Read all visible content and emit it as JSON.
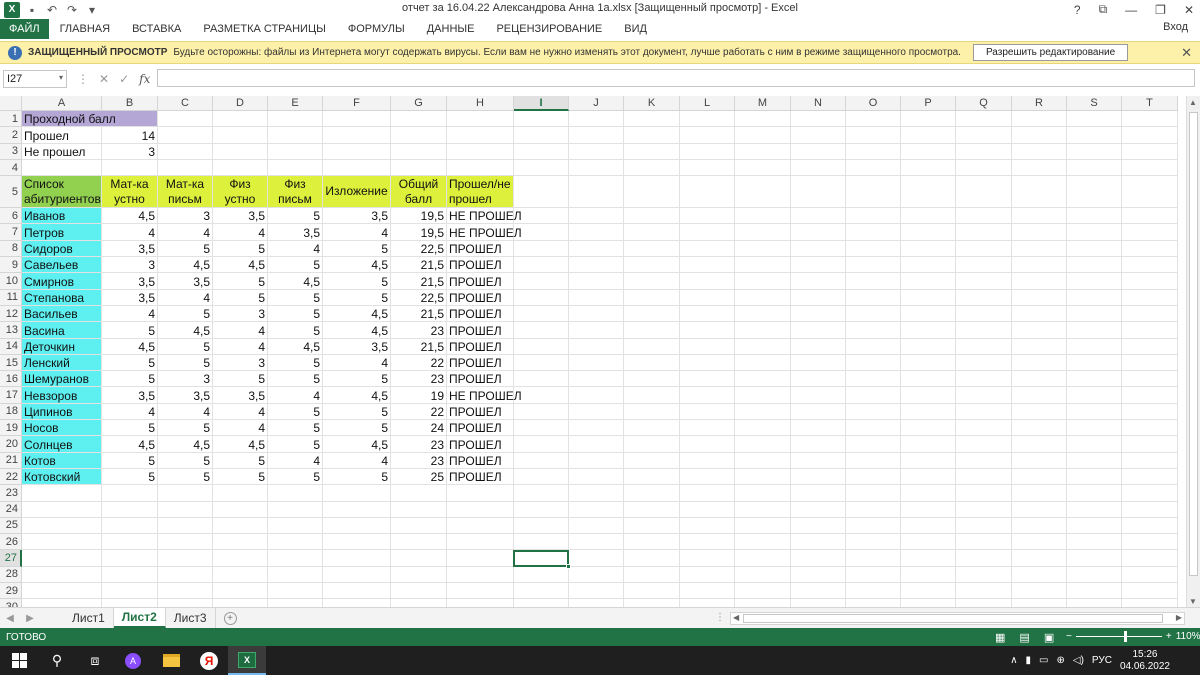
{
  "window": {
    "title": "отчет за 16.04.22 Александрова Анна 1a.xlsx  [Защищенный просмотр] - Excel",
    "signin": "Вход",
    "help": "?",
    "app_badge": "X",
    "qat_save": "▪",
    "qat_undo": "↶",
    "qat_redo": "↷",
    "qat_more": "▾",
    "ribbon_display": "⧉",
    "minimize": "—",
    "restore": "❐",
    "close": "✕"
  },
  "ribbon_tabs": [
    "ФАЙЛ",
    "ГЛАВНАЯ",
    "ВСТАВКА",
    "РАЗМЕТКА СТРАНИЦЫ",
    "ФОРМУЛЫ",
    "ДАННЫЕ",
    "РЕЦЕНЗИРОВАНИЕ",
    "ВИД"
  ],
  "protected_view": {
    "icon": "!",
    "title": "ЗАЩИЩЕННЫЙ ПРОСМОТР",
    "message": "Будьте осторожны: файлы из Интернета могут содержать вирусы. Если вам не нужно изменять этот документ, лучше работать с ним в режиме защищенного просмотра.",
    "button": "Разрешить редактирование",
    "close": "✕"
  },
  "formula_bar": {
    "name_box": "I27",
    "dropdown": "▾",
    "separator": "⋮",
    "cancel": "✕",
    "enter": "✓",
    "fx": "fx",
    "formula": ""
  },
  "columns": [
    "A",
    "B",
    "C",
    "D",
    "E",
    "F",
    "G",
    "H",
    "I",
    "J",
    "K",
    "L",
    "M",
    "N",
    "O",
    "P",
    "Q",
    "R",
    "S",
    "T"
  ],
  "selected_column": "I",
  "selected_row": 27,
  "summary": {
    "title": "Проходной балл",
    "passed_label": "Прошел",
    "passed_value": "14",
    "failed_label": "Не прошел",
    "failed_value": "3"
  },
  "table_headers": [
    "Список абитуриентов",
    "Мат-ка устно",
    "Мат-ка письм",
    "Физ устно",
    "Физ письм",
    "Изложение",
    "Общий балл",
    "Прошел/не прошел"
  ],
  "students": [
    [
      "Иванов",
      "4,5",
      "3",
      "3,5",
      "5",
      "3,5",
      "19,5",
      "НЕ ПРОШЕЛ"
    ],
    [
      "Петров",
      "4",
      "4",
      "4",
      "3,5",
      "4",
      "19,5",
      "НЕ ПРОШЕЛ"
    ],
    [
      "Сидоров",
      "3,5",
      "5",
      "5",
      "4",
      "5",
      "22,5",
      "ПРОШЕЛ"
    ],
    [
      "Савельев",
      "3",
      "4,5",
      "4,5",
      "5",
      "4,5",
      "21,5",
      "ПРОШЕЛ"
    ],
    [
      "Смирнов",
      "3,5",
      "3,5",
      "5",
      "4,5",
      "5",
      "21,5",
      "ПРОШЕЛ"
    ],
    [
      "Степанова",
      "3,5",
      "4",
      "5",
      "5",
      "5",
      "22,5",
      "ПРОШЕЛ"
    ],
    [
      "Васильев",
      "4",
      "5",
      "3",
      "5",
      "4,5",
      "21,5",
      "ПРОШЕЛ"
    ],
    [
      "Васина",
      "5",
      "4,5",
      "4",
      "5",
      "4,5",
      "23",
      "ПРОШЕЛ"
    ],
    [
      "Деточкин",
      "4,5",
      "5",
      "4",
      "4,5",
      "3,5",
      "21,5",
      "ПРОШЕЛ"
    ],
    [
      "Ленский",
      "5",
      "5",
      "3",
      "5",
      "4",
      "22",
      "ПРОШЕЛ"
    ],
    [
      "Шемуранов",
      "5",
      "3",
      "5",
      "5",
      "5",
      "23",
      "ПРОШЕЛ"
    ],
    [
      "Невзоров",
      "3,5",
      "3,5",
      "3,5",
      "4",
      "4,5",
      "19",
      "НЕ ПРОШЕЛ"
    ],
    [
      "Ципинов",
      "4",
      "4",
      "4",
      "5",
      "5",
      "22",
      "ПРОШЕЛ"
    ],
    [
      "Носов",
      "5",
      "5",
      "4",
      "5",
      "5",
      "24",
      "ПРОШЕЛ"
    ],
    [
      "Солнцев",
      "4,5",
      "4,5",
      "4,5",
      "5",
      "4,5",
      "23",
      "ПРОШЕЛ"
    ],
    [
      "Котов",
      "5",
      "5",
      "5",
      "4",
      "4",
      "23",
      "ПРОШЕЛ"
    ],
    [
      "Котовский",
      "5",
      "5",
      "5",
      "5",
      "5",
      "25",
      "ПРОШЕЛ"
    ]
  ],
  "row_numbers": [
    "1",
    "2",
    "3",
    "4",
    "5",
    "6",
    "7",
    "8",
    "9",
    "10",
    "11",
    "12",
    "13",
    "14",
    "15",
    "16",
    "17",
    "18",
    "19",
    "20",
    "21",
    "22",
    "23",
    "24",
    "25",
    "26",
    "27",
    "28",
    "29",
    "30"
  ],
  "sheet_nav": {
    "prev": "◀",
    "next": "▶",
    "add": "+",
    "menu": "⋮"
  },
  "sheets": [
    "Лист1",
    "Лист2",
    "Лист3"
  ],
  "active_sheet": "Лист2",
  "status": {
    "ready": "ГОТОВО",
    "zoom": "110%",
    "zoom_out": "−",
    "zoom_in": "+",
    "view_normal": "▦",
    "view_layout": "▤",
    "view_break": "▣"
  },
  "taskbar": {
    "search": "⚲",
    "taskview": "⧈",
    "alice": "A",
    "yandex": "Я",
    "excel": "X",
    "tray_up": "∧",
    "tray_mic": "▮",
    "tray_battery": "▭",
    "tray_network": "⊕",
    "tray_sound": "◁)",
    "lang": "РУС",
    "time": "15:26",
    "date": "04.06.2022"
  },
  "colors": {
    "excel_green": "#217346",
    "purple": "#b4a7d6",
    "green": "#92d050",
    "yellow": "#dcf03c",
    "cyan": "#5ef0f0",
    "pv_bar": "#fdf1a9"
  }
}
